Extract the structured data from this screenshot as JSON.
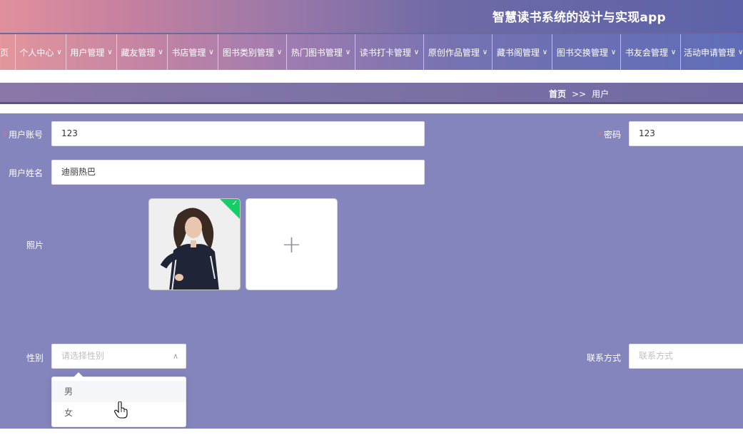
{
  "header": {
    "title": "智慧读书系统的设计与实现app"
  },
  "nav": {
    "items": [
      {
        "label": "页",
        "has_chevron": false
      },
      {
        "label": "个人中心",
        "has_chevron": true
      },
      {
        "label": "用户管理",
        "has_chevron": true
      },
      {
        "label": "藏友管理",
        "has_chevron": true
      },
      {
        "label": "书店管理",
        "has_chevron": true
      },
      {
        "label": "图书类别管理",
        "has_chevron": true
      },
      {
        "label": "热门图书管理",
        "has_chevron": true
      },
      {
        "label": "读书打卡管理",
        "has_chevron": true
      },
      {
        "label": "原创作品管理",
        "has_chevron": true
      },
      {
        "label": "藏书阁管理",
        "has_chevron": true
      },
      {
        "label": "图书交换管理",
        "has_chevron": true
      },
      {
        "label": "书友会管理",
        "has_chevron": true
      },
      {
        "label": "活动申请管理",
        "has_chevron": true
      }
    ]
  },
  "breadcrumb": {
    "home": "首页",
    "separator": ">>",
    "current": "用户"
  },
  "form": {
    "account": {
      "label": "用户账号",
      "required": "*",
      "value": "123"
    },
    "password": {
      "label": "密码",
      "required": "*",
      "value": "123"
    },
    "name": {
      "label": "用户姓名",
      "value": "迪丽热巴"
    },
    "photo": {
      "label": "照片",
      "upload_icon": "+",
      "check_icon": "✓",
      "hint": ""
    },
    "gender": {
      "label": "性别",
      "placeholder": "请选择性别",
      "options": [
        "男",
        "女"
      ],
      "hovered_index": 0
    },
    "contact": {
      "label": "联系方式",
      "placeholder": "联系方式"
    }
  },
  "colors": {
    "form_bg": "#8585bd",
    "required": "#f56c6c",
    "success": "#13ce66"
  }
}
